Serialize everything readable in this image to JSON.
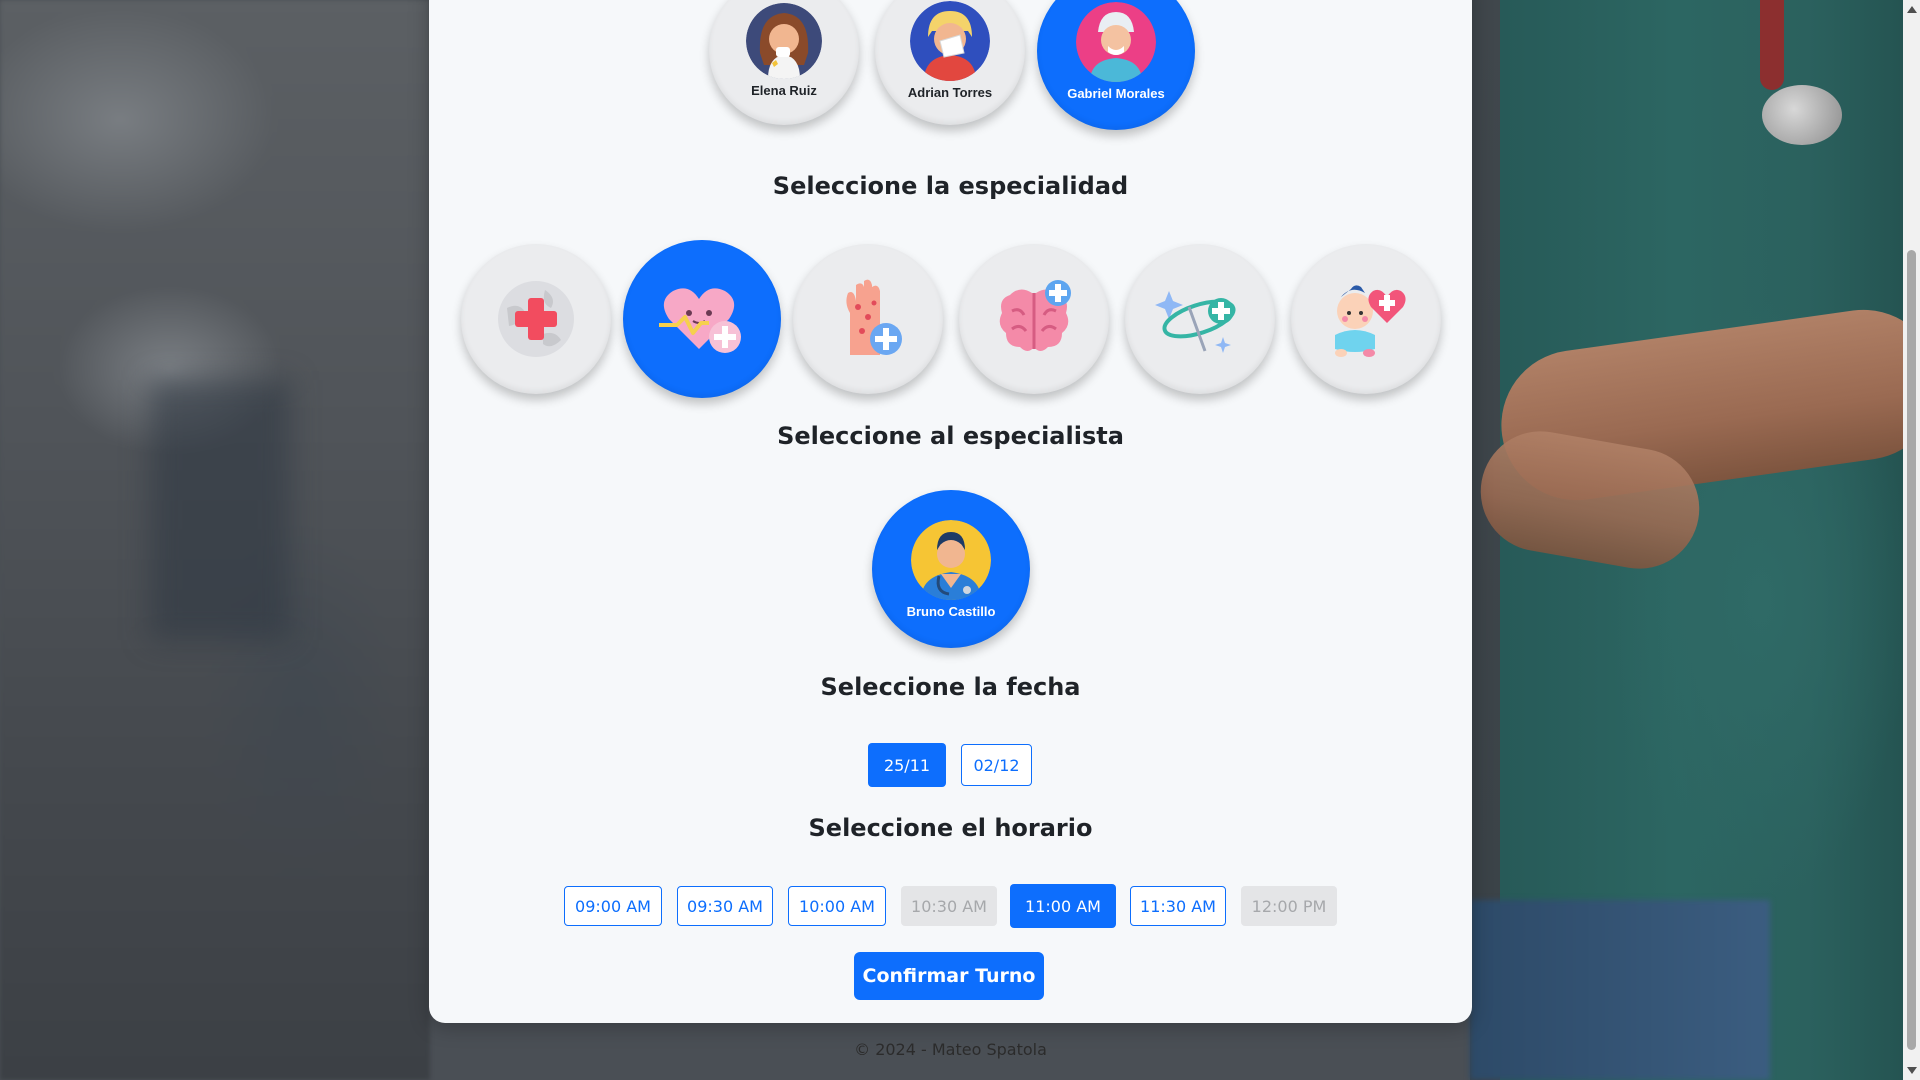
{
  "patients": [
    {
      "name": "Elena Ruiz",
      "icon": "sick-woman-avatar-icon",
      "selected": false
    },
    {
      "name": "Adrian Torres",
      "icon": "sneezing-man-avatar-icon",
      "selected": false
    },
    {
      "name": "Gabriel Morales",
      "icon": "elderly-man-avatar-icon",
      "selected": true
    }
  ],
  "specialty_section": {
    "title": "Seleccione la especialidad",
    "items": [
      {
        "icon": "globe-medical-cross-icon",
        "selected": false
      },
      {
        "icon": "heart-cardiology-icon",
        "selected": true
      },
      {
        "icon": "skin-dermatology-icon",
        "selected": false
      },
      {
        "icon": "brain-neurology-icon",
        "selected": false
      },
      {
        "icon": "tooth-dentistry-icon",
        "selected": false
      },
      {
        "icon": "baby-pediatrics-icon",
        "selected": false
      }
    ]
  },
  "specialist_section": {
    "title": "Seleccione al especialista",
    "specialist": {
      "name": "Bruno Castillo",
      "icon": "doctor-avatar-icon",
      "selected": true
    }
  },
  "date_section": {
    "title": "Seleccione la fecha",
    "dates": [
      {
        "label": "25/11",
        "state": "selected"
      },
      {
        "label": "02/12",
        "state": "available"
      }
    ]
  },
  "time_section": {
    "title": "Seleccione el horario",
    "times": [
      {
        "label": "09:00 AM",
        "state": "available"
      },
      {
        "label": "09:30 AM",
        "state": "available"
      },
      {
        "label": "10:00 AM",
        "state": "available"
      },
      {
        "label": "10:30 AM",
        "state": "disabled"
      },
      {
        "label": "11:00 AM",
        "state": "selected"
      },
      {
        "label": "11:30 AM",
        "state": "available"
      },
      {
        "label": "12:00 PM",
        "state": "disabled"
      }
    ]
  },
  "confirm_label": "Confirmar Turno",
  "footer": "© 2024 - Mateo Spatola",
  "colors": {
    "accent": "#0d6efd",
    "card": "#f6f8fa",
    "disabled": "#e4e5e7"
  }
}
